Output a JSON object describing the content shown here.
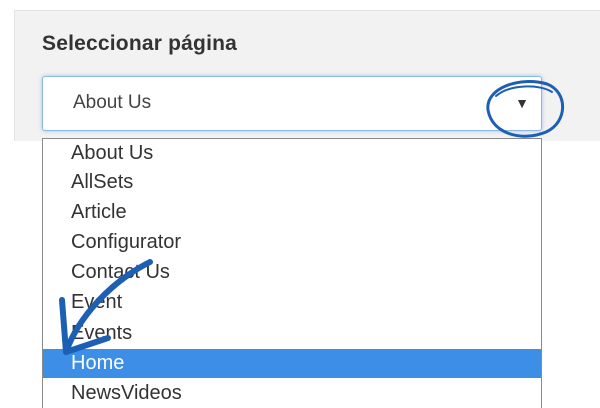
{
  "panel": {
    "label": "Seleccionar página"
  },
  "select": {
    "value": "About Us",
    "arrow_icon": "triangle-down-icon"
  },
  "dropdown": {
    "options": [
      "About Us",
      "AllSets",
      "Article",
      "Configurator",
      "Contact Us",
      "Event",
      "Events",
      "Home",
      "NewsVideos"
    ],
    "highlighted": "Home"
  },
  "colors": {
    "highlight": "#3c8ee6",
    "annotation": "#1d5fb3"
  }
}
